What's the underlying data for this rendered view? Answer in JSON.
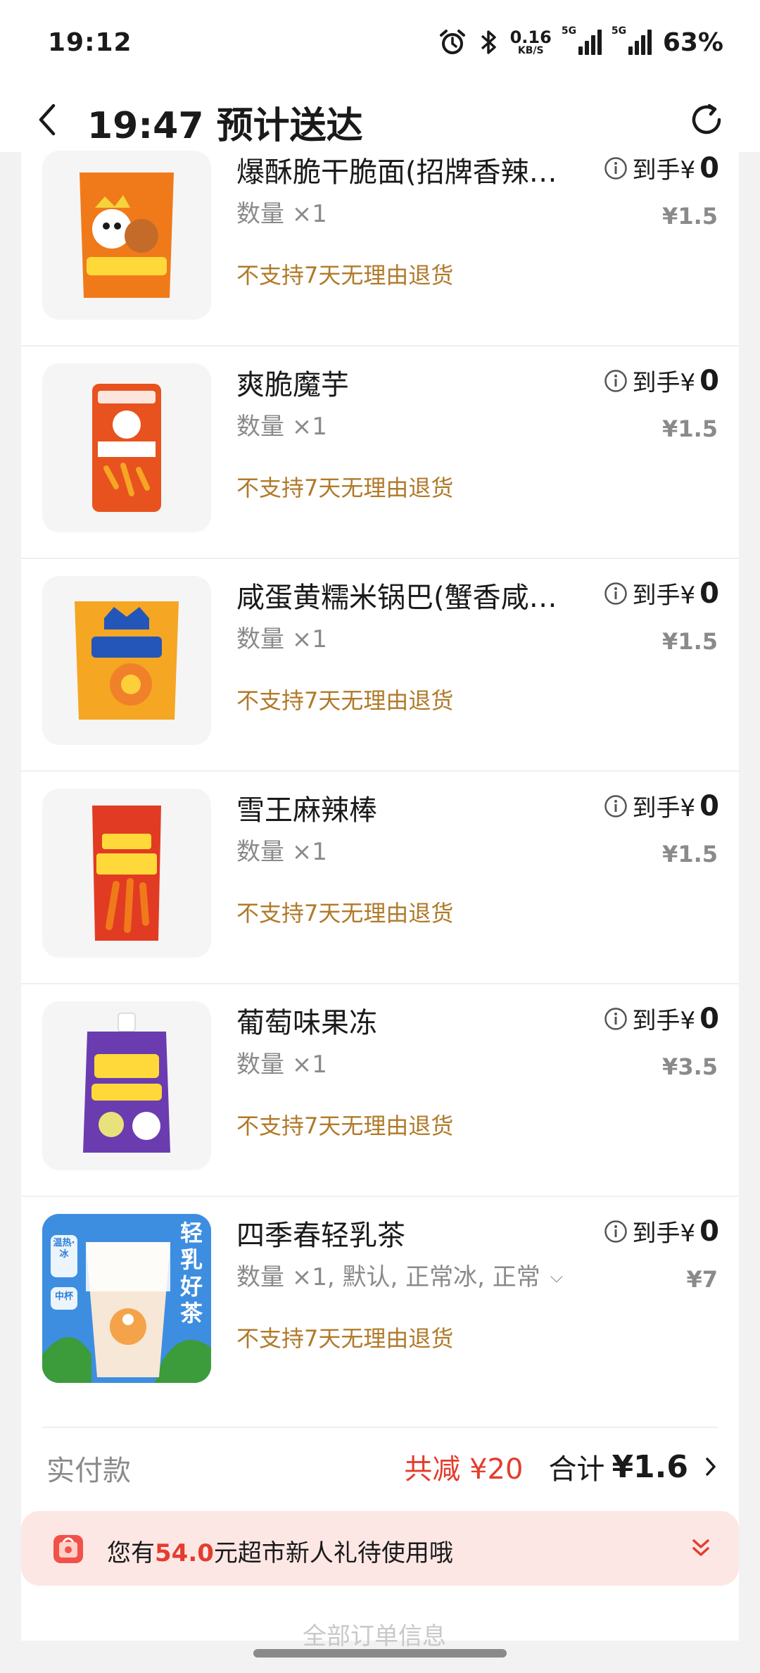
{
  "status_bar": {
    "time": "19:12",
    "net_speed": "0.16",
    "net_unit": "KB/S",
    "signal1_tag": "5G",
    "signal2_tag": "5G",
    "battery": "63%"
  },
  "nav": {
    "title": "19:47 预计送达"
  },
  "items": [
    {
      "name": "爆酥脆干脆面(招牌香辣…",
      "qty": "数量 ×1",
      "return_policy": "不支持7天无理由退货",
      "price_label": "到手¥",
      "price": "0",
      "original_price": "¥1.5",
      "thumb_color": "#f07a1a"
    },
    {
      "name": "爽脆魔芋",
      "qty": "数量 ×1",
      "return_policy": "不支持7天无理由退货",
      "price_label": "到手¥",
      "price": "0",
      "original_price": "¥1.5",
      "thumb_color": "#e8521f"
    },
    {
      "name": "咸蛋黄糯米锅巴(蟹香咸…",
      "qty": "数量 ×1",
      "return_policy": "不支持7天无理由退货",
      "price_label": "到手¥",
      "price": "0",
      "original_price": "¥1.5",
      "thumb_color": "#f5a623"
    },
    {
      "name": "雪王麻辣棒",
      "qty": "数量 ×1",
      "return_policy": "不支持7天无理由退货",
      "price_label": "到手¥",
      "price": "0",
      "original_price": "¥1.5",
      "thumb_color": "#e23b23"
    },
    {
      "name": "葡萄味果冻",
      "qty": "数量 ×1",
      "return_policy": "不支持7天无理由退货",
      "price_label": "到手¥",
      "price": "0",
      "original_price": "¥3.5",
      "thumb_color": "#6a3cb0"
    },
    {
      "name": "四季春轻乳茶",
      "qty": "数量 ×1, 默认, 正常冰, 正常",
      "return_policy": "不支持7天无理由退货",
      "price_label": "到手¥",
      "price": "0",
      "original_price": "¥7",
      "thumb_color": "#2f7fd6"
    }
  ],
  "milk_tea_thumb": {
    "badge1": "温热·冰",
    "badge2": "中杯",
    "vertical_text": "轻乳好茶"
  },
  "totals": {
    "label": "实付款",
    "discount": "共减 ¥20",
    "total_label": "合计",
    "total_value": "¥1.6"
  },
  "promo": {
    "prefix": "您有",
    "amount": "54.0",
    "suffix": "元超市新人礼待使用哦"
  },
  "cutoff": {
    "text": "全部订单信息"
  },
  "colors": {
    "accent_red": "#e33d2e",
    "return_policy": "#b07a2a",
    "promo_bg": "#fde7e5"
  }
}
